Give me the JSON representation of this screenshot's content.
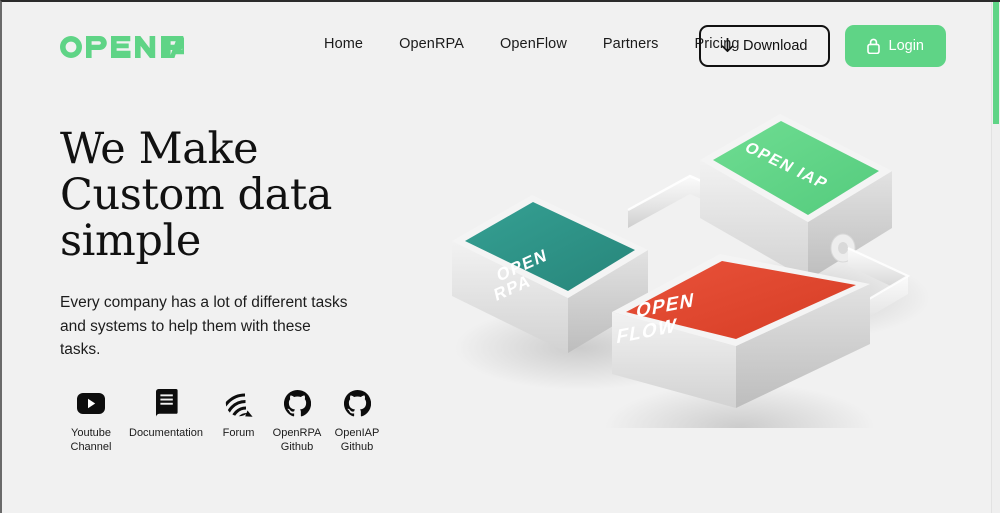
{
  "brand": {
    "logo_text": "OPEN IAP",
    "logo_color": "#5fd486"
  },
  "nav": {
    "items": [
      {
        "label": "Home"
      },
      {
        "label": "OpenRPA"
      },
      {
        "label": "OpenFlow"
      },
      {
        "label": "Partners"
      },
      {
        "label": "Pricing"
      }
    ]
  },
  "actions": {
    "download": {
      "label": "Download",
      "icon": "download-arrow-icon"
    },
    "login": {
      "label": "Login",
      "icon": "lock-icon",
      "color": "#5fd486"
    }
  },
  "hero": {
    "headline_lines": [
      "We Make",
      "Custom data",
      "simple"
    ],
    "subcopy": "Every company has a lot of different tasks and systems to help them with these tasks."
  },
  "links": [
    {
      "label": "Youtube\nChannel",
      "icon": "youtube-icon"
    },
    {
      "label": "Documentation",
      "icon": "book-icon"
    },
    {
      "label": "Forum",
      "icon": "discourse-icon"
    },
    {
      "label": "OpenRPA\nGithub",
      "icon": "github-icon"
    },
    {
      "label": "OpenIAP\nGithub",
      "icon": "github-icon"
    }
  ],
  "illustration": {
    "cubes": [
      {
        "name": "openrpa-cube",
        "label_lines": [
          "OPEN",
          "RPA"
        ],
        "color": "#2d9183"
      },
      {
        "name": "openiap-cube",
        "label_lines": [
          "OPEN IAP"
        ],
        "color": "#5fd486"
      },
      {
        "name": "openflow-cube",
        "label_lines": [
          "OPEN",
          "FLOW"
        ],
        "color": "#e0452c"
      }
    ]
  },
  "scrollbar": {
    "thumb_color": "#5fd486"
  }
}
